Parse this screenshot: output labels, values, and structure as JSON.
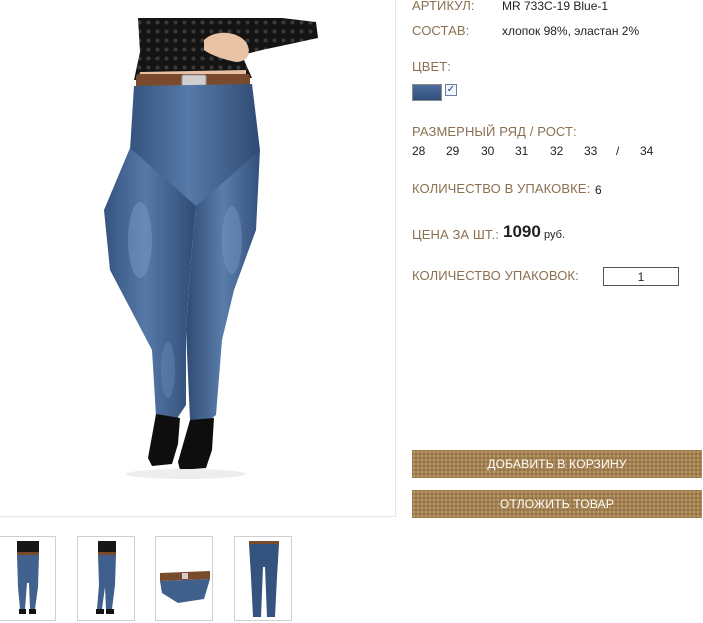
{
  "product": {
    "article_label": "АРТИКУЛ:",
    "article_value": "MR 733C-19 Blue-1",
    "composition_label": "СОСТАВ:",
    "composition_value": "хлопок 98%, эластан 2%",
    "color_label": "ЦВЕТ:",
    "color_swatch": {
      "name": "blue-denim",
      "hex": "#3f5f8f",
      "selected": true,
      "check_glyph": "✓"
    },
    "sizes_label": "РАЗМЕРНЫЙ РЯД / РОСТ:",
    "sizes": [
      "28",
      "29",
      "30",
      "31",
      "32",
      "33",
      "/",
      "34"
    ],
    "pack_qty_label": "КОЛИЧЕСТВО В УПАКОВКЕ:",
    "pack_qty_value": "6",
    "price_label": "ЦЕНА ЗА ШТ.:",
    "price_value": "1090",
    "price_unit": "руб.",
    "packs_label": "КОЛИЧЕСТВО УПАКОВОК:",
    "packs_value": "1"
  },
  "actions": {
    "add_to_cart": "ДОБАВИТЬ В КОРЗИНУ",
    "postpone": "ОТЛОЖИТЬ ТОВАР"
  },
  "gallery": {
    "thumbnails": [
      "front-view",
      "side-view",
      "waist-detail",
      "flat-lay"
    ]
  },
  "colors": {
    "label": "#8a7050",
    "button": "#a3804e",
    "denim": "#3f5f8f",
    "top": "#1a1a1a"
  }
}
